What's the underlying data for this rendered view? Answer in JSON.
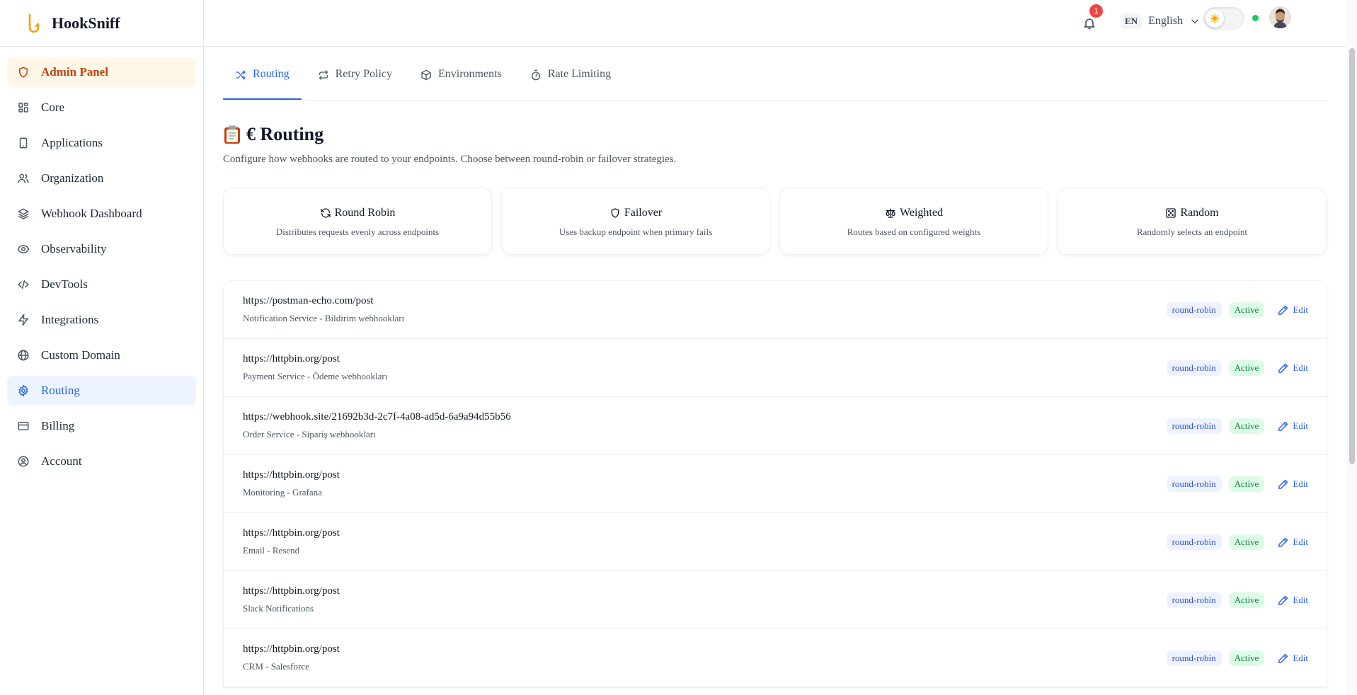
{
  "brand": {
    "name": "HookSniff"
  },
  "sidebar": {
    "items": [
      {
        "label": "Admin Panel",
        "icon": "shield-icon"
      },
      {
        "label": "Core",
        "icon": "grid-icon"
      },
      {
        "label": "Applications",
        "icon": "phone-icon"
      },
      {
        "label": "Organization",
        "icon": "users-icon"
      },
      {
        "label": "Webhook Dashboard",
        "icon": "layers-icon"
      },
      {
        "label": "Observability",
        "icon": "eye-icon"
      },
      {
        "label": "DevTools",
        "icon": "code-icon"
      },
      {
        "label": "Integrations",
        "icon": "zap-icon"
      },
      {
        "label": "Custom Domain",
        "icon": "globe-icon"
      },
      {
        "label": "Routing",
        "icon": "gear-icon"
      },
      {
        "label": "Billing",
        "icon": "credit-card-icon"
      },
      {
        "label": "Account",
        "icon": "user-circle-icon"
      }
    ],
    "active": "Routing"
  },
  "topbar": {
    "notifications_count": "1",
    "language_code": "EN",
    "language_label": "English",
    "theme": "light"
  },
  "tabs": [
    {
      "label": "Routing",
      "icon": "shuffle-icon"
    },
    {
      "label": "Retry Policy",
      "icon": "repeat-icon"
    },
    {
      "label": "Environments",
      "icon": "box-icon"
    },
    {
      "label": "Rate Limiting",
      "icon": "timer-icon"
    }
  ],
  "page": {
    "title": "€ Routing",
    "description": "Configure how webhooks are routed to your endpoints. Choose between round-robin or failover strategies."
  },
  "strategies": [
    {
      "title": "Round Robin",
      "description": "Distributes requests evenly across endpoints",
      "icon": "refresh-icon"
    },
    {
      "title": "Failover",
      "description": "Uses backup endpoint when primary fails",
      "icon": "shield-icon"
    },
    {
      "title": "Weighted",
      "description": "Routes based on configured weights",
      "icon": "scale-icon"
    },
    {
      "title": "Random",
      "description": "Randomly selects an endpoint",
      "icon": "dice-icon"
    }
  ],
  "endpoints": [
    {
      "url": "https://postman-echo.com/post",
      "name": "Notification Service - Bildirim webhookları",
      "strategy": "round-robin",
      "status": "Active",
      "action": "Edit"
    },
    {
      "url": "https://httpbin.org/post",
      "name": "Payment Service - Ödeme webhookları",
      "strategy": "round-robin",
      "status": "Active",
      "action": "Edit"
    },
    {
      "url": "https://webhook.site/21692b3d-2c7f-4a08-ad5d-6a9a94d55b56",
      "name": "Order Service - Sipariş webhookları",
      "strategy": "round-robin",
      "status": "Active",
      "action": "Edit"
    },
    {
      "url": "https://httpbin.org/post",
      "name": "Monitoring - Grafana",
      "strategy": "round-robin",
      "status": "Active",
      "action": "Edit"
    },
    {
      "url": "https://httpbin.org/post",
      "name": "Email - Resend",
      "strategy": "round-robin",
      "status": "Active",
      "action": "Edit"
    },
    {
      "url": "https://httpbin.org/post",
      "name": "Slack Notifications",
      "strategy": "round-robin",
      "status": "Active",
      "action": "Edit"
    },
    {
      "url": "https://httpbin.org/post",
      "name": "CRM - Salesforce",
      "strategy": "round-robin",
      "status": "Active",
      "action": "Edit"
    }
  ],
  "colors": {
    "accent": "#2563eb",
    "admin": "#c2410c",
    "active_badge": "#15803d",
    "notification": "#ef4444",
    "online": "#22c55e"
  }
}
